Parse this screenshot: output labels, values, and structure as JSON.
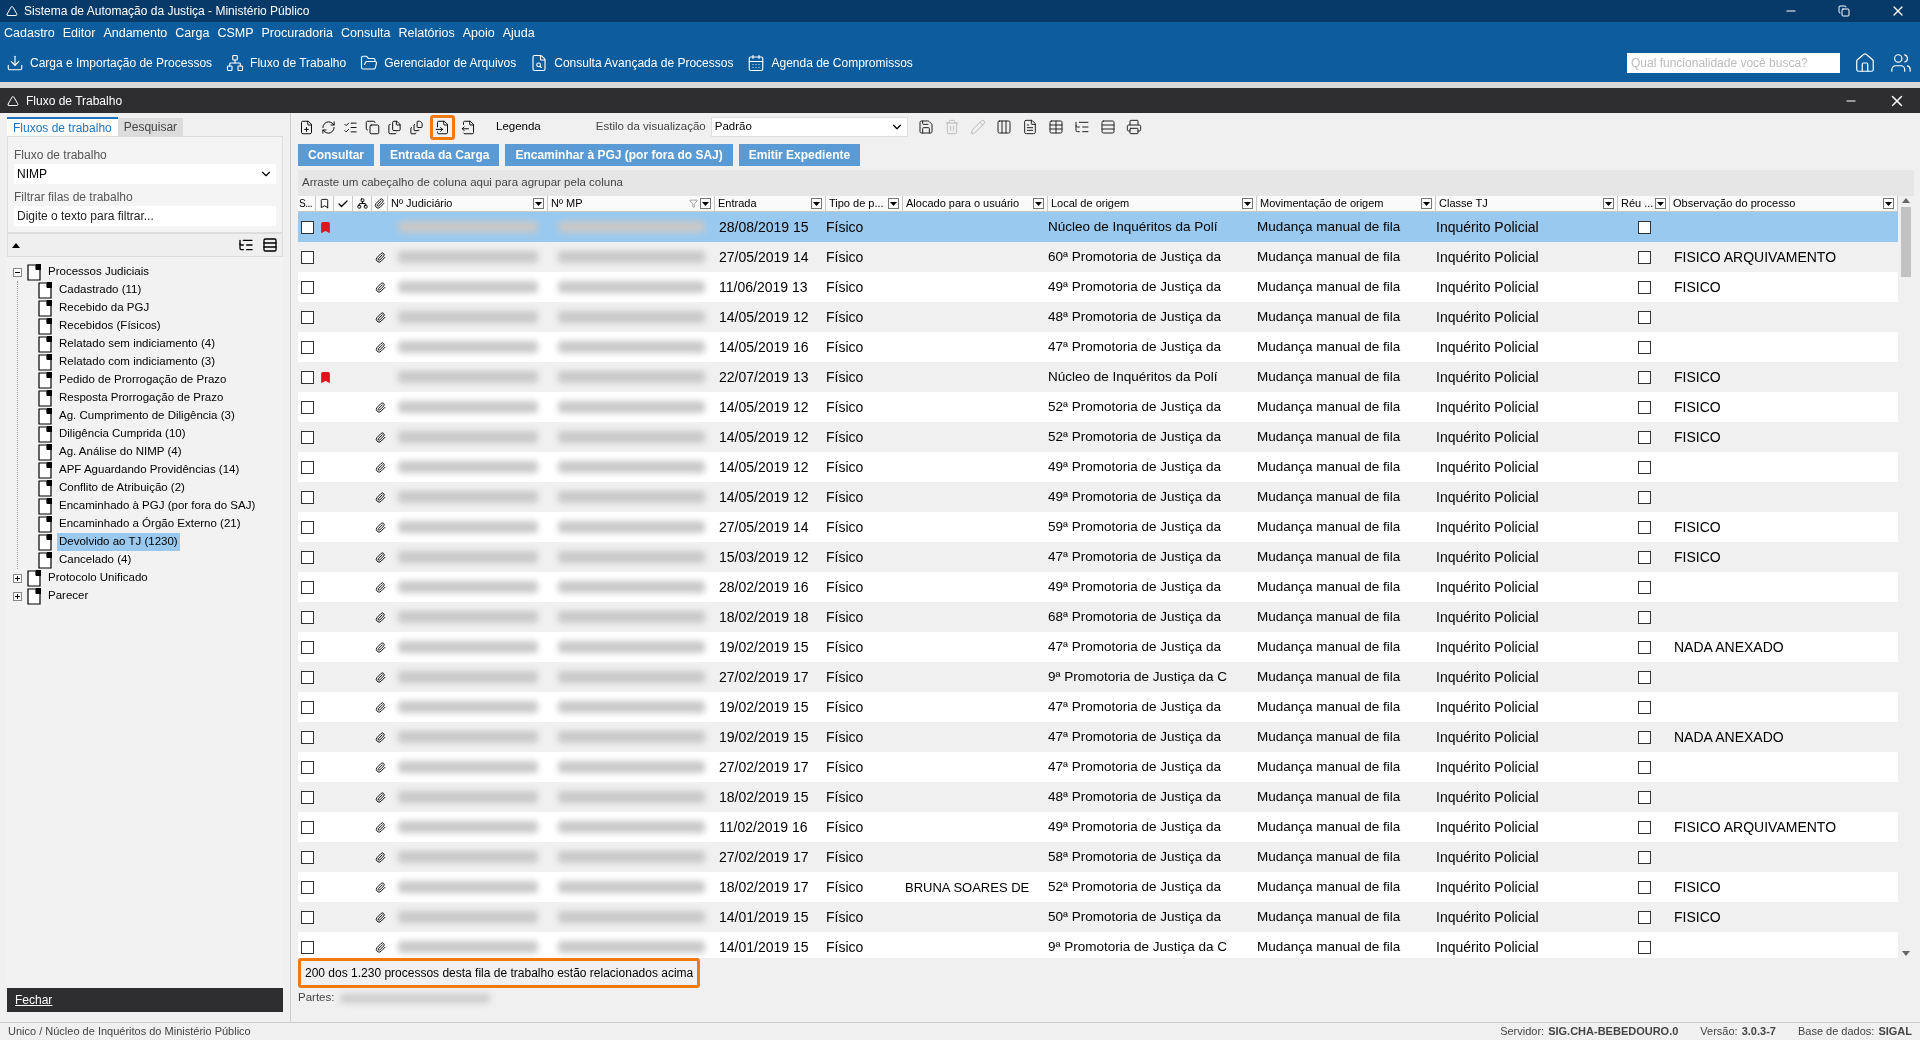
{
  "window": {
    "title": "Sistema de Automação da Justiça - Ministério Público"
  },
  "menu": [
    "Cadastro",
    "Editor",
    "Andamento",
    "Carga",
    "CSMP",
    "Procuradoria",
    "Consulta",
    "Relatórios",
    "Apoio",
    "Ajuda"
  ],
  "toolbar": [
    "Carga e Importação de Processos",
    "Fluxo de Trabalho",
    "Gerenciador de Arquivos",
    "Consulta Avançada de Processos",
    "Agenda de Compromissos"
  ],
  "search": {
    "placeholder": "Qual funcionalidade você busca?"
  },
  "subwindow": {
    "title": "Fluxo de Trabalho"
  },
  "left": {
    "tabs": [
      {
        "label": "Fluxos de trabalho",
        "selected": true
      },
      {
        "label": "Pesquisar",
        "selected": false
      }
    ],
    "flow_label": "Fluxo de trabalho",
    "flow_value": "NIMP",
    "filter_label": "Filtrar filas de trabalho",
    "filter_placeholder": "Digite o texto para filtrar...",
    "tree": [
      {
        "label": "Processos Judiciais",
        "expanded": true,
        "selected": false,
        "children": [
          {
            "label": "Cadastrado (11)",
            "selected": false
          },
          {
            "label": "Recebido da PGJ",
            "selected": false
          },
          {
            "label": "Recebidos (Físicos)",
            "selected": false
          },
          {
            "label": "Relatado sem indiciamento (4)",
            "selected": false
          },
          {
            "label": "Relatado com indiciamento (3)",
            "selected": false
          },
          {
            "label": "Pedido de Prorrogação de Prazo",
            "selected": false
          },
          {
            "label": "Resposta Prorrogação de Prazo",
            "selected": false
          },
          {
            "label": "Ag. Cumprimento de Diligência (3)",
            "selected": false
          },
          {
            "label": "Diligência Cumprida (10)",
            "selected": false
          },
          {
            "label": "Ag. Análise do NIMP (4)",
            "selected": false
          },
          {
            "label": "APF Aguardando Providências (14)",
            "selected": false
          },
          {
            "label": "Conflito de Atribuição (2)",
            "selected": false
          },
          {
            "label": "Encaminhado à PGJ (por fora do SAJ)",
            "selected": false
          },
          {
            "label": "Encaminhado a Órgão Externo (21)",
            "selected": false
          },
          {
            "label": "Devolvido ao TJ (1230)",
            "selected": true
          },
          {
            "label": "Cancelado (4)",
            "selected": false
          }
        ]
      },
      {
        "label": "Protocolo Unificado",
        "expanded": false,
        "selected": false
      },
      {
        "label": "Parecer",
        "expanded": false,
        "selected": false
      }
    ],
    "close_button": "Fechar"
  },
  "grid": {
    "tools": [
      {
        "highlighted": false
      },
      {
        "highlighted": false
      },
      {
        "highlighted": false
      },
      {
        "highlighted": false
      },
      {
        "highlighted": false
      },
      {
        "highlighted": false
      },
      {
        "highlighted": true
      },
      {
        "highlighted": false
      }
    ],
    "legend": "Legenda",
    "view_label": "Estilo da visualização",
    "view_value": "Padrão",
    "view_tools": [
      {
        "disabled": false
      },
      {
        "disabled": true
      },
      {
        "disabled": true
      },
      {
        "disabled": false
      },
      {
        "disabled": false
      },
      {
        "disabled": false
      },
      {
        "disabled": false
      },
      {
        "disabled": false
      },
      {
        "disabled": false
      }
    ],
    "buttons": [
      "Consultar",
      "Entrada da Carga",
      "Encaminhar à PGJ (por fora do SAJ)",
      "Emitir Expediente"
    ],
    "group_hint": "Arraste um cabeçalho de coluna aqui para agrupar pela coluna",
    "columns": [
      "S...",
      "Nº Judiciário",
      "Nº MP",
      "Entrada",
      "Tipo de p...",
      "Alocado para o usuário",
      "Local de origem",
      "Movimentação de origem",
      "Classe TJ",
      "Réu ...",
      "Observação do processo"
    ],
    "rows": [
      {
        "selected": true,
        "checked": false,
        "flag": true,
        "clip": false,
        "entrada": "28/08/2019 15",
        "tipo": "Físico",
        "local": "Núcleo de Inquéritos da Polí",
        "mov": "Mudança manual de fila",
        "classe": "Inquérito Policial",
        "reu": false
      },
      {
        "selected": false,
        "checked": false,
        "flag": false,
        "clip": true,
        "entrada": "27/05/2019 14",
        "tipo": "Físico",
        "local": "60ª Promotoria de Justiça da",
        "mov": "Mudança manual de fila",
        "classe": "Inquérito Policial",
        "reu": false,
        "obs": "FISICO ARQUIVAMENTO"
      },
      {
        "selected": false,
        "checked": false,
        "flag": false,
        "clip": true,
        "entrada": "11/06/2019 13",
        "tipo": "Físico",
        "local": "49ª Promotoria de Justiça da",
        "mov": "Mudança manual de fila",
        "classe": "Inquérito Policial",
        "reu": false,
        "obs": "FISICO"
      },
      {
        "selected": false,
        "checked": false,
        "flag": false,
        "clip": true,
        "entrada": "14/05/2019 12",
        "tipo": "Físico",
        "local": "48ª Promotoria de Justiça da",
        "mov": "Mudança manual de fila",
        "classe": "Inquérito Policial",
        "reu": false
      },
      {
        "selected": false,
        "checked": false,
        "flag": false,
        "clip": true,
        "entrada": "14/05/2019 16",
        "tipo": "Físico",
        "local": "47ª Promotoria de Justiça da",
        "mov": "Mudança manual de fila",
        "classe": "Inquérito Policial",
        "reu": false
      },
      {
        "selected": false,
        "checked": false,
        "flag": true,
        "clip": false,
        "entrada": "22/07/2019 13",
        "tipo": "Físico",
        "local": "Núcleo de Inquéritos da Polí",
        "mov": "Mudança manual de fila",
        "classe": "Inquérito Policial",
        "reu": false,
        "obs": "FISICO"
      },
      {
        "selected": false,
        "checked": false,
        "flag": false,
        "clip": true,
        "entrada": "14/05/2019 12",
        "tipo": "Físico",
        "local": "52ª Promotoria de Justiça da",
        "mov": "Mudança manual de fila",
        "classe": "Inquérito Policial",
        "reu": false,
        "obs": "FISICO"
      },
      {
        "selected": false,
        "checked": false,
        "flag": false,
        "clip": true,
        "entrada": "14/05/2019 12",
        "tipo": "Físico",
        "local": "52ª Promotoria de Justiça da",
        "mov": "Mudança manual de fila",
        "classe": "Inquérito Policial",
        "reu": false,
        "obs": "FISICO"
      },
      {
        "selected": false,
        "checked": false,
        "flag": false,
        "clip": true,
        "entrada": "14/05/2019 12",
        "tipo": "Físico",
        "local": "49ª Promotoria de Justiça da",
        "mov": "Mudança manual de fila",
        "classe": "Inquérito Policial",
        "reu": false
      },
      {
        "selected": false,
        "checked": false,
        "flag": false,
        "clip": true,
        "entrada": "14/05/2019 12",
        "tipo": "Físico",
        "local": "49ª Promotoria de Justiça da",
        "mov": "Mudança manual de fila",
        "classe": "Inquérito Policial",
        "reu": false
      },
      {
        "selected": false,
        "checked": false,
        "flag": false,
        "clip": true,
        "entrada": "27/05/2019 14",
        "tipo": "Físico",
        "local": "59ª Promotoria de Justiça da",
        "mov": "Mudança manual de fila",
        "classe": "Inquérito Policial",
        "reu": false,
        "obs": "FISICO"
      },
      {
        "selected": false,
        "checked": false,
        "flag": false,
        "clip": true,
        "entrada": "15/03/2019 12",
        "tipo": "Físico",
        "local": "47ª Promotoria de Justiça da",
        "mov": "Mudança manual de fila",
        "classe": "Inquérito Policial",
        "reu": false,
        "obs": "FISICO"
      },
      {
        "selected": false,
        "checked": false,
        "flag": false,
        "clip": true,
        "entrada": "28/02/2019 16",
        "tipo": "Físico",
        "local": "49ª Promotoria de Justiça da",
        "mov": "Mudança manual de fila",
        "classe": "Inquérito Policial",
        "reu": false
      },
      {
        "selected": false,
        "checked": false,
        "flag": false,
        "clip": true,
        "entrada": "18/02/2019 18",
        "tipo": "Físico",
        "local": "68ª Promotoria de Justiça da",
        "mov": "Mudança manual de fila",
        "classe": "Inquérito Policial",
        "reu": false
      },
      {
        "selected": false,
        "checked": false,
        "flag": false,
        "clip": true,
        "entrada": "19/02/2019 15",
        "tipo": "Físico",
        "local": "47ª Promotoria de Justiça da",
        "mov": "Mudança manual de fila",
        "classe": "Inquérito Policial",
        "reu": false,
        "obs": "NADA ANEXADO"
      },
      {
        "selected": false,
        "checked": false,
        "flag": false,
        "clip": true,
        "entrada": "27/02/2019 17",
        "tipo": "Físico",
        "local": "9ª Promotoria de Justiça da C",
        "mov": "Mudança manual de fila",
        "classe": "Inquérito Policial",
        "reu": false
      },
      {
        "selected": false,
        "checked": false,
        "flag": false,
        "clip": true,
        "entrada": "19/02/2019 15",
        "tipo": "Físico",
        "local": "47ª Promotoria de Justiça da",
        "mov": "Mudança manual de fila",
        "classe": "Inquérito Policial",
        "reu": false
      },
      {
        "selected": false,
        "checked": false,
        "flag": false,
        "clip": true,
        "entrada": "19/02/2019 15",
        "tipo": "Físico",
        "local": "47ª Promotoria de Justiça da",
        "mov": "Mudança manual de fila",
        "classe": "Inquérito Policial",
        "reu": false,
        "obs": "NADA ANEXADO"
      },
      {
        "selected": false,
        "checked": false,
        "flag": false,
        "clip": true,
        "entrada": "27/02/2019 17",
        "tipo": "Físico",
        "local": "47ª Promotoria de Justiça da",
        "mov": "Mudança manual de fila",
        "classe": "Inquérito Policial",
        "reu": false
      },
      {
        "selected": false,
        "checked": false,
        "flag": false,
        "clip": true,
        "entrada": "18/02/2019 15",
        "tipo": "Físico",
        "local": "48ª Promotoria de Justiça da",
        "mov": "Mudança manual de fila",
        "classe": "Inquérito Policial",
        "reu": false
      },
      {
        "selected": false,
        "checked": false,
        "flag": false,
        "clip": true,
        "entrada": "11/02/2019 16",
        "tipo": "Físico",
        "local": "49ª Promotoria de Justiça da",
        "mov": "Mudança manual de fila",
        "classe": "Inquérito Policial",
        "reu": false,
        "obs": "FISICO ARQUIVAMENTO"
      },
      {
        "selected": false,
        "checked": false,
        "flag": false,
        "clip": true,
        "entrada": "27/02/2019 17",
        "tipo": "Físico",
        "local": "58ª Promotoria de Justiça da",
        "mov": "Mudança manual de fila",
        "classe": "Inquérito Policial",
        "reu": false
      },
      {
        "selected": false,
        "checked": false,
        "flag": false,
        "clip": true,
        "entrada": "18/02/2019 17",
        "tipo": "Físico",
        "alocado": "BRUNA SOARES DE",
        "local": "52ª Promotoria de Justiça da",
        "mov": "Mudança manual de fila",
        "classe": "Inquérito Policial",
        "reu": false,
        "obs": "FISICO"
      },
      {
        "selected": false,
        "checked": false,
        "flag": false,
        "clip": true,
        "entrada": "14/01/2019 15",
        "tipo": "Físico",
        "local": "50ª Promotoria de Justiça da",
        "mov": "Mudança manual de fila",
        "classe": "Inquérito Policial",
        "reu": false,
        "obs": "FISICO"
      },
      {
        "selected": false,
        "checked": false,
        "flag": false,
        "clip": true,
        "entrada": "14/01/2019 15",
        "tipo": "Físico",
        "local": "9ª Promotoria de Justiça da C",
        "mov": "Mudança manual de fila",
        "classe": "Inquérito Policial",
        "reu": false
      }
    ],
    "count_text": "200 dos 1.230 processos desta fila de trabalho estão relacionados acima",
    "count_highlighted": true,
    "parties_label": "Partes:"
  },
  "status_bar": {
    "location": "Unico / Núcleo de Inquéritos do Ministério Público",
    "items": [
      {
        "label": "Servidor:",
        "value": "SIG.CHA-BEBEDOURO.0"
      },
      {
        "label": "Versão:",
        "value": "3.0.3-7"
      },
      {
        "label": "Base de dados:",
        "value": "SIGAL"
      }
    ]
  }
}
